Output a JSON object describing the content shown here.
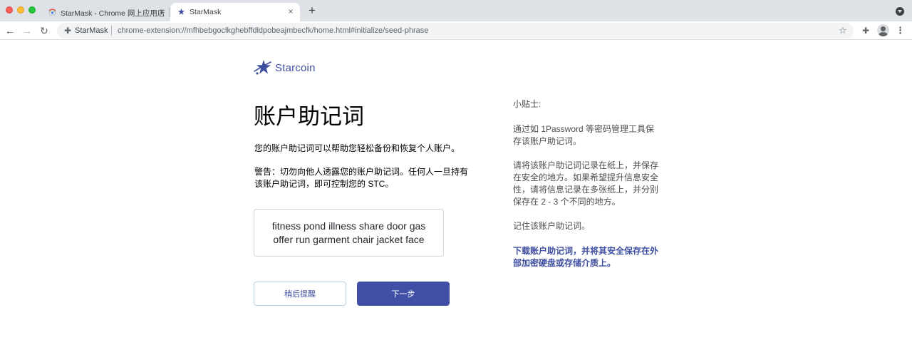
{
  "window": {
    "controls": [
      "close",
      "minimize",
      "zoom"
    ]
  },
  "tabs": [
    {
      "title": "StarMask - Chrome 网上应用店",
      "icon": "chrome-web-store-icon",
      "active": false,
      "close": "×"
    },
    {
      "title": "StarMask",
      "icon": "starcoin-icon",
      "active": true,
      "close": "×"
    }
  ],
  "tabstrip": {
    "new_tab": "+"
  },
  "toolbar": {
    "back": "←",
    "forward": "→",
    "reload": "↻",
    "site_label": "StarMask",
    "url": "chrome-extension://mfhbebgoclkghebffdldpobeajmbecfk/home.html#initialize/seed-phrase",
    "bookmark": "☆",
    "extensions": "✚",
    "menu": "⋮"
  },
  "logo": {
    "text": "Starcoin",
    "color": "#3f4fa0"
  },
  "main": {
    "title": "账户助记词",
    "description": "您的账户助记词可以帮助您轻松备份和恢复个人账户。",
    "warning": "警告：切勿向他人透露您的账户助记词。任何人一旦持有该账户助记词，即可控制您的 STC。",
    "seed_phrase": "fitness pond illness share door gas offer run garment chair jacket face",
    "remind_later_label": "稍后提醒",
    "next_label": "下一步"
  },
  "tips": {
    "title": "小贴士:",
    "items": [
      "通过如 1Password 等密码管理工具保存该账户助记词。",
      "请将该账户助记词记录在纸上，并保存在安全的地方。如果希望提升信息安全性，请将信息记录在多张纸上，并分别保存在 2 - 3 个不同的地方。",
      "记住该账户助记词。"
    ],
    "download_link": "下载账户助记词，并将其安全保存在外部加密硬盘或存储介质上。"
  },
  "colors": {
    "primary": "#4150a6",
    "link": "#3f4fa0",
    "tabstrip": "#dee1e6"
  }
}
